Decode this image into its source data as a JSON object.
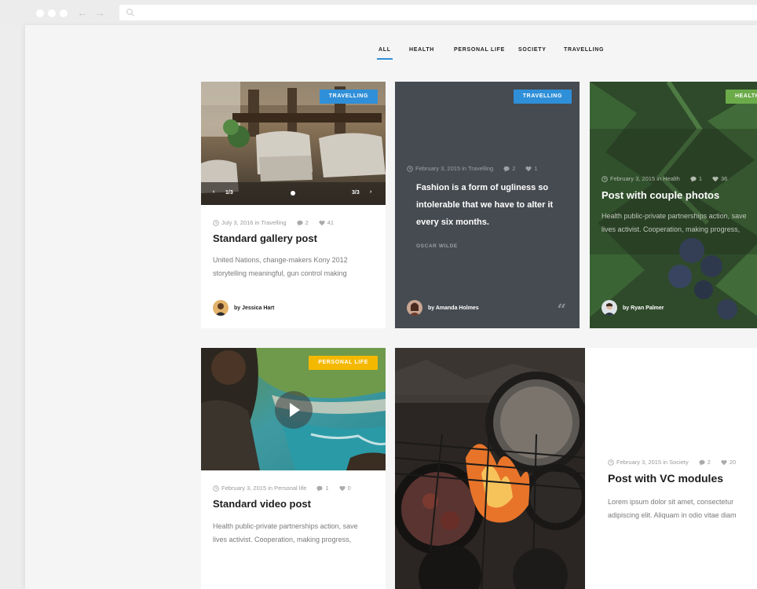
{
  "browser": {
    "nav_back": "←",
    "nav_forward": "→"
  },
  "filters": [
    "All",
    "Health",
    "Personal life",
    "Society",
    "Travelling"
  ],
  "colors": {
    "accent": "#2f8fd8",
    "travelling": "#2f8fd8",
    "health": "#6cab4a",
    "personal_life": "#f5b800",
    "quote_bg": "#464b51"
  },
  "cards": {
    "gallery": {
      "tag": "Travelling",
      "slider_left": "1/3",
      "slider_right": "3/3",
      "meta_date": "July 3, 2016 in Travelling",
      "comments": "2",
      "likes": "41",
      "title": "Standard gallery post",
      "excerpt": "United Nations, change-makers Kony 2012 storytelling meaningful, gun control making",
      "author": "by Jessica Hart"
    },
    "quote": {
      "tag": "Travelling",
      "meta_date": "February 3, 2015 in Travelling",
      "comments": "2",
      "likes": "1",
      "quote": "Fashion is a form of ugliness so intolerable that we have to alter it every six months.",
      "quote_author": "Oscar Wilde",
      "author": "by Amanda Holmes",
      "quote_mark": "“"
    },
    "couple": {
      "tag": "Health",
      "meta_date": "February 3, 2015 in Health",
      "comments": "1",
      "likes": "36",
      "title": "Post with couple photos",
      "excerpt": "Health public-private partnerships action, save lives activist. Cooperation, making progress,",
      "author": "by Ryan Palmer"
    },
    "video": {
      "tag": "Personal life",
      "meta_date": "February 3, 2015 in Personal life",
      "comments": "1",
      "likes": "0",
      "title": "Standard video post",
      "excerpt": "Health public-private partnerships action, save lives activist. Cooperation, making progress,"
    },
    "vc": {
      "meta_date": "February 3, 2015 in Society",
      "comments": "2",
      "likes": "20",
      "title": "Post with VC modules",
      "excerpt": "Lorem ipsum dolor sit amet, consectetur adipiscing elit. Aliquam in odio vitae diam"
    }
  }
}
